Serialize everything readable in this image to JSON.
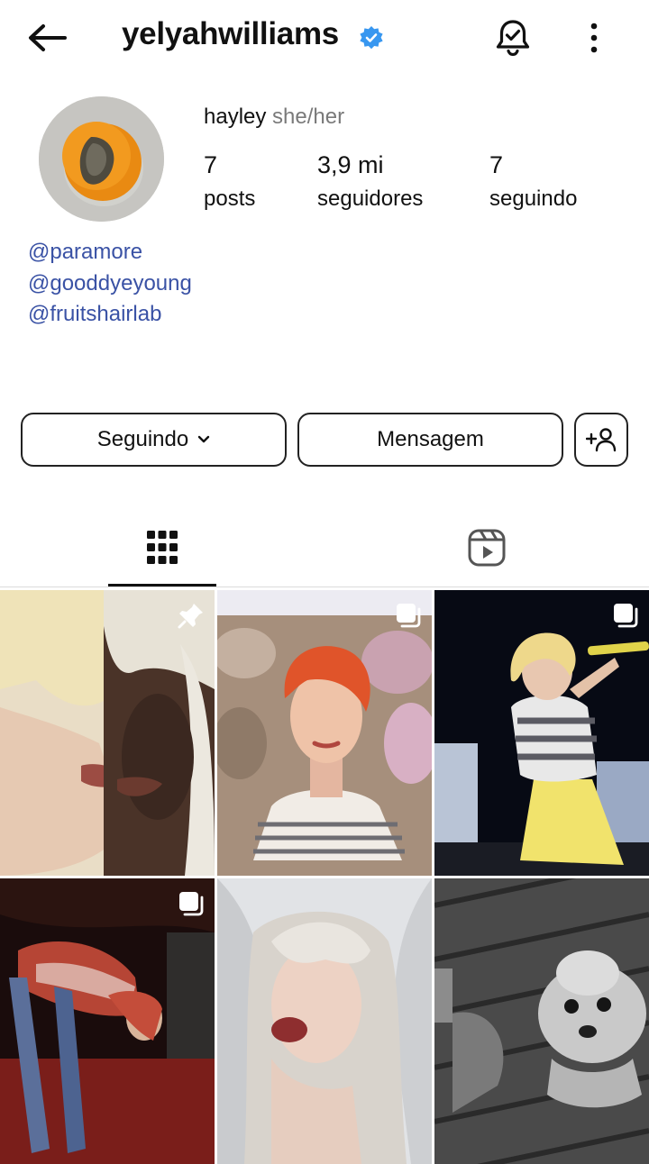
{
  "header": {
    "username": "yelyahwilliams",
    "icons": [
      "back-arrow-icon",
      "verified-badge-icon",
      "notification-bell-icon",
      "more-options-icon"
    ]
  },
  "profile": {
    "display_name": "hayley",
    "pronouns": "she/her",
    "stats": [
      {
        "value": "7",
        "label": "posts"
      },
      {
        "value": "3,9 mi",
        "label": "seguidores"
      },
      {
        "value": "7",
        "label": "seguindo"
      }
    ],
    "bio_links": [
      "@paramore",
      "@gooddyeyoung",
      "@fruitshairlab"
    ]
  },
  "actions": {
    "follow_label": "Seguindo",
    "message_label": "Mensagem"
  },
  "tabs": {
    "active": "grid",
    "icons": [
      "grid-icon",
      "reels-icon"
    ]
  },
  "posts": [
    {
      "badge": "pinned-icon"
    },
    {
      "badge": "carousel-icon"
    },
    {
      "badge": "carousel-icon"
    },
    {
      "badge": "carousel-icon"
    },
    {
      "badge": ""
    },
    {
      "badge": ""
    }
  ],
  "colors": {
    "link": "#3a52a5",
    "verified": "#3897f0",
    "border": "#222222"
  }
}
